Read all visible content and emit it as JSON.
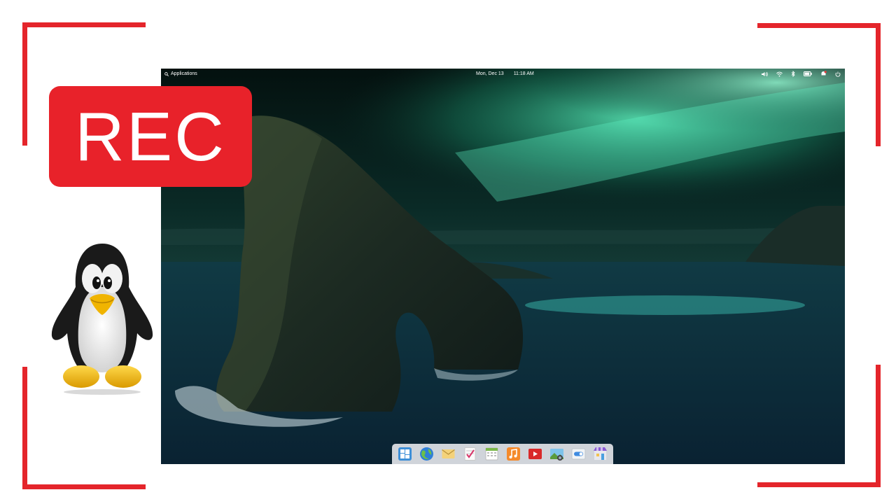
{
  "frame": {
    "accent": "#e4252b"
  },
  "rec_badge": {
    "label": "REC",
    "color": "#e8222a"
  },
  "mascot": {
    "icon": "tux-penguin-icon"
  },
  "desktop": {
    "topbar": {
      "applications_label": "Applications",
      "date": "Mon, Dec 13",
      "time": "11:18 AM",
      "indicators": [
        "volume-icon",
        "wifi-icon",
        "bluetooth-icon",
        "battery-icon",
        "notifications-icon",
        "power-icon"
      ]
    },
    "wallpaper": {
      "description_icon": "aurora-sea-arch-wallpaper"
    },
    "dock": {
      "apps": [
        {
          "name": "multitasking-view",
          "icon": "multitasking-icon"
        },
        {
          "name": "web-browser",
          "icon": "globe-icon"
        },
        {
          "name": "mail",
          "icon": "mail-icon"
        },
        {
          "name": "tasks",
          "icon": "tasks-icon"
        },
        {
          "name": "calendar",
          "icon": "calendar-icon"
        },
        {
          "name": "music",
          "icon": "music-icon"
        },
        {
          "name": "videos",
          "icon": "video-icon"
        },
        {
          "name": "photos",
          "icon": "photos-icon"
        },
        {
          "name": "system-settings",
          "icon": "settings-toggle-icon"
        },
        {
          "name": "app-center",
          "icon": "appcenter-icon"
        }
      ]
    }
  }
}
